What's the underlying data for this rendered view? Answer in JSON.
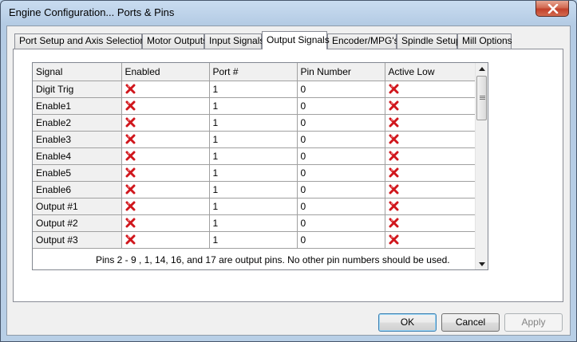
{
  "window": {
    "title": "Engine Configuration... Ports & Pins",
    "close_icon": "close-icon"
  },
  "tabs": [
    {
      "label": "Port Setup and Axis Selection"
    },
    {
      "label": "Motor Outputs"
    },
    {
      "label": "Input Signals"
    },
    {
      "label": "Output Signals",
      "active": true
    },
    {
      "label": "Encoder/MPG's"
    },
    {
      "label": "Spindle Setup"
    },
    {
      "label": "Mill Options"
    }
  ],
  "grid": {
    "headers": {
      "signal": "Signal",
      "enabled": "Enabled",
      "port": "Port #",
      "pin": "Pin Number",
      "active_low": "Active Low"
    },
    "rows": [
      {
        "signal": "Digit  Trig",
        "port": "1",
        "pin": "0"
      },
      {
        "signal": "Enable1",
        "port": "1",
        "pin": "0"
      },
      {
        "signal": "Enable2",
        "port": "1",
        "pin": "0"
      },
      {
        "signal": "Enable3",
        "port": "1",
        "pin": "0"
      },
      {
        "signal": "Enable4",
        "port": "1",
        "pin": "0"
      },
      {
        "signal": "Enable5",
        "port": "1",
        "pin": "0"
      },
      {
        "signal": "Enable6",
        "port": "1",
        "pin": "0"
      },
      {
        "signal": "Output #1",
        "port": "1",
        "pin": "0"
      },
      {
        "signal": "Output #2",
        "port": "1",
        "pin": "0"
      },
      {
        "signal": "Output #3",
        "port": "1",
        "pin": "0"
      }
    ],
    "cell_icon": "red-x-icon"
  },
  "note": "Pins 2 - 9 , 1, 14, 16, and 17 are output pins. No  other pin numbers should be used.",
  "buttons": {
    "ok": "OK",
    "cancel": "Cancel",
    "apply": "Apply"
  },
  "colors": {
    "x_icon": "#d0161c",
    "titlebar": "#bcd3ea"
  }
}
